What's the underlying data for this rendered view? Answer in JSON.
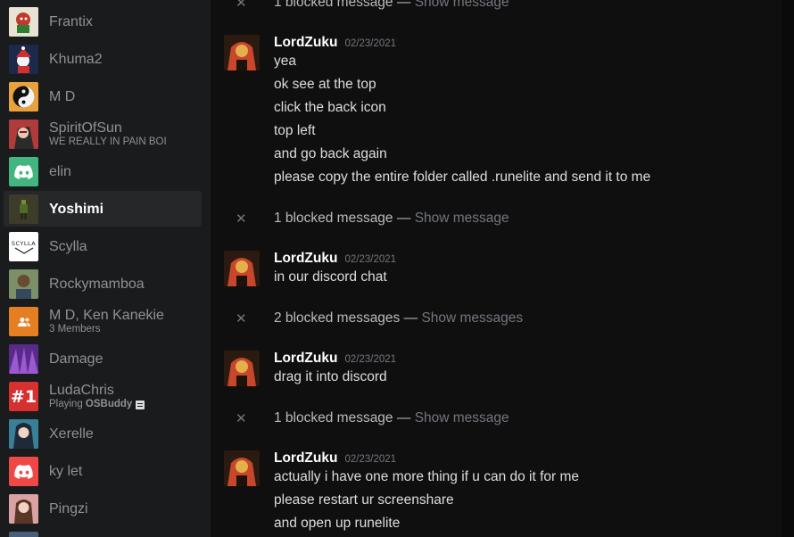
{
  "sidebar": {
    "dms": [
      {
        "name": "Frantix",
        "sub": "",
        "avatar_icon": "cartoon-avatar",
        "avatar_color": "#7a6a52"
      },
      {
        "name": "Khuma2",
        "sub": "",
        "avatar_icon": "santa-avatar",
        "avatar_color": "#c0392b"
      },
      {
        "name": "M D",
        "sub": "",
        "avatar_icon": "yin-yang-avatar",
        "avatar_color": "#e9a23b"
      },
      {
        "name": "SpiritOfSun",
        "sub": "WE REALLY IN PAIN BOI",
        "avatar_icon": "anime-avatar",
        "avatar_color": "#b13a3a"
      },
      {
        "name": "elin",
        "sub": "",
        "avatar_icon": "discord-logo-icon",
        "avatar_color": "#43b581"
      },
      {
        "name": "Yoshimi",
        "sub": "",
        "avatar_icon": "pixel-character-avatar",
        "avatar_color": "#3d3b2a"
      },
      {
        "name": "Scylla",
        "sub": "",
        "avatar_icon": "scylla-logo-avatar",
        "avatar_color": "#ffffff",
        "avatar_text": "SCYLLA"
      },
      {
        "name": "Rockymamboa",
        "sub": "",
        "avatar_icon": "photo-avatar",
        "avatar_color": "#6b7d5a"
      },
      {
        "name": "M D, Ken Kanekie",
        "sub": "3 Members",
        "avatar_icon": "group-icon",
        "avatar_color": "#e67e22"
      },
      {
        "name": "Damage",
        "sub": "",
        "avatar_icon": "purple-avatar",
        "avatar_color": "#7d3fb5"
      },
      {
        "name": "LudaChris",
        "sub_prefix": "Playing ",
        "sub_game": "OSBuddy",
        "avatar_icon": "number-one-avatar",
        "avatar_color": "#d63031",
        "avatar_text": "#1"
      },
      {
        "name": "Xerelle",
        "sub": "",
        "avatar_icon": "anime-girl-avatar",
        "avatar_color": "#4b9bb5"
      },
      {
        "name": "ky let",
        "sub": "",
        "avatar_icon": "discord-logo-icon",
        "avatar_color": "#f04747"
      },
      {
        "name": "Pingzi",
        "sub": "",
        "avatar_icon": "photo-avatar",
        "avatar_color": "#c98b8b"
      }
    ]
  },
  "chat": {
    "blocked": [
      {
        "count_text": "1 blocked message",
        "sep": " — ",
        "action": "Show message"
      },
      {
        "count_text": "1 blocked message",
        "sep": " — ",
        "action": "Show message"
      },
      {
        "count_text": "2 blocked messages",
        "sep": " — ",
        "action": "Show messages"
      },
      {
        "count_text": "1 blocked message",
        "sep": " — ",
        "action": "Show message"
      }
    ],
    "groups": [
      {
        "author": "LordZuku",
        "timestamp": "02/23/2021",
        "lines": [
          "yea",
          "ok see at the top",
          "click the back icon",
          "top left",
          "and go back again",
          "please copy the entire folder called .runelite and send it to me"
        ]
      },
      {
        "author": "LordZuku",
        "timestamp": "02/23/2021",
        "lines": [
          "in our discord chat"
        ]
      },
      {
        "author": "LordZuku",
        "timestamp": "02/23/2021",
        "lines": [
          "drag it into discord"
        ]
      },
      {
        "author": "LordZuku",
        "timestamp": "02/23/2021",
        "lines": [
          "actually i have one more thing if u can do it for me",
          "please restart ur screenshare",
          "and open up runelite"
        ]
      }
    ],
    "author_avatar_colors": [
      "#2b1a10",
      "#c8462a",
      "#e3b04b"
    ]
  }
}
